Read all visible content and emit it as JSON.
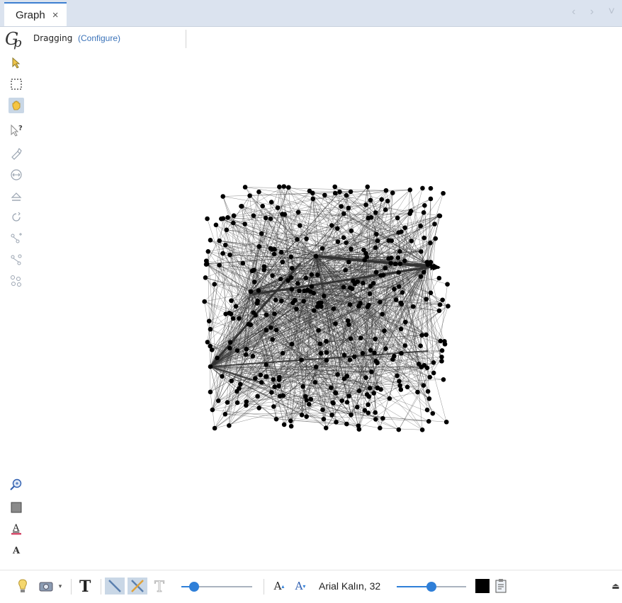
{
  "tab": {
    "title": "Graph",
    "close": "×"
  },
  "nav": {
    "arrows": "‹ › ˅"
  },
  "toolbar": {
    "mode": "Dragging",
    "configure": "(Configure)"
  },
  "bottom": {
    "font_label": "Arial Kalın, 32",
    "size_up": "A",
    "size_down": "A",
    "text_slider_value": 0.18,
    "font_slider_value": 0.5,
    "color": "#000000"
  },
  "graph": {
    "node_color": "#000000",
    "edge_color": "#333333"
  }
}
